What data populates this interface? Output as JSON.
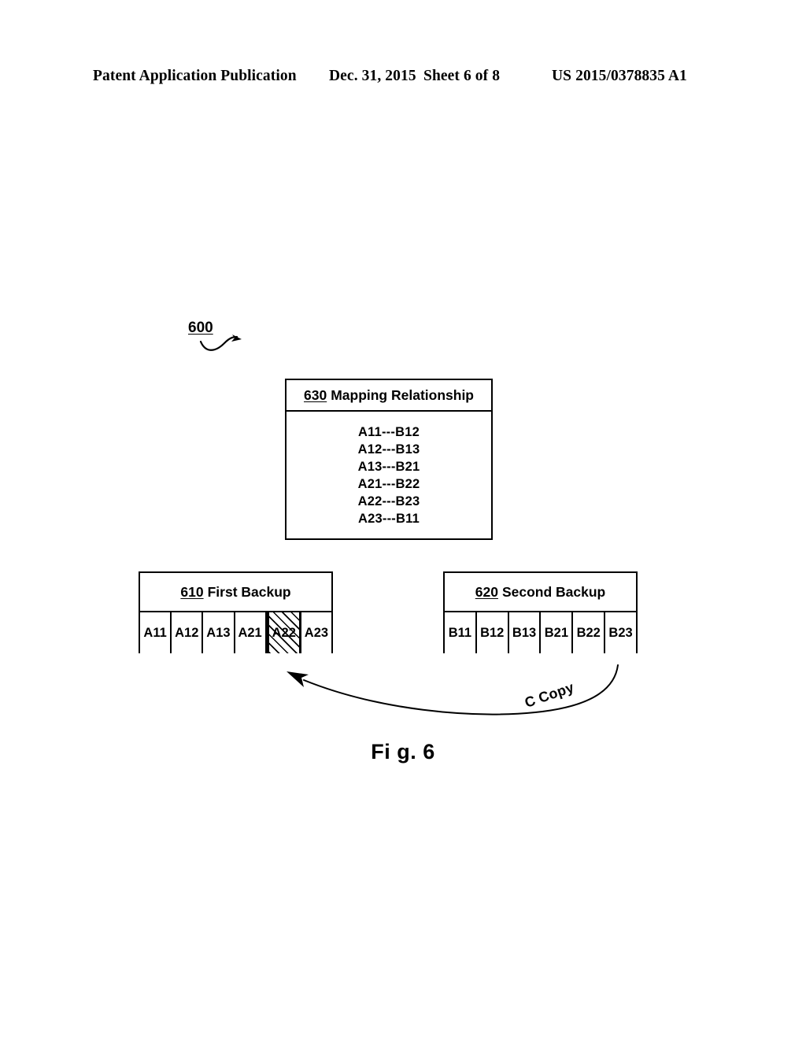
{
  "header": {
    "publication": "Patent Application Publication",
    "date": "Dec. 31, 2015",
    "sheet": "Sheet 6 of 8",
    "patent_number": "US 2015/0378835 A1"
  },
  "figure": {
    "reference_number": "600",
    "caption": "Fi g. 6"
  },
  "mapping_box": {
    "number": "630",
    "title": "Mapping Relationship",
    "rows": [
      "A11---B12",
      "A12---B13",
      "A13---B21",
      "A21---B22",
      "A22---B23",
      "A23---B11"
    ]
  },
  "first_backup": {
    "number": "610",
    "title": "First Backup",
    "cells": [
      {
        "label": "A11",
        "hatched": false
      },
      {
        "label": "A12",
        "hatched": false
      },
      {
        "label": "A13",
        "hatched": false
      },
      {
        "label": "A21",
        "hatched": false
      },
      {
        "label": "A22",
        "hatched": true
      },
      {
        "label": "A23",
        "hatched": false
      }
    ]
  },
  "second_backup": {
    "number": "620",
    "title": "Second Backup",
    "cells": [
      {
        "label": "B11",
        "hatched": false
      },
      {
        "label": "B12",
        "hatched": false
      },
      {
        "label": "B13",
        "hatched": false
      },
      {
        "label": "B21",
        "hatched": false
      },
      {
        "label": "B22",
        "hatched": false
      },
      {
        "label": "B23",
        "hatched": false
      }
    ]
  },
  "copy_arrow": {
    "label": "C Copy"
  },
  "colors": {
    "ink": "#000000",
    "paper": "#ffffff"
  }
}
